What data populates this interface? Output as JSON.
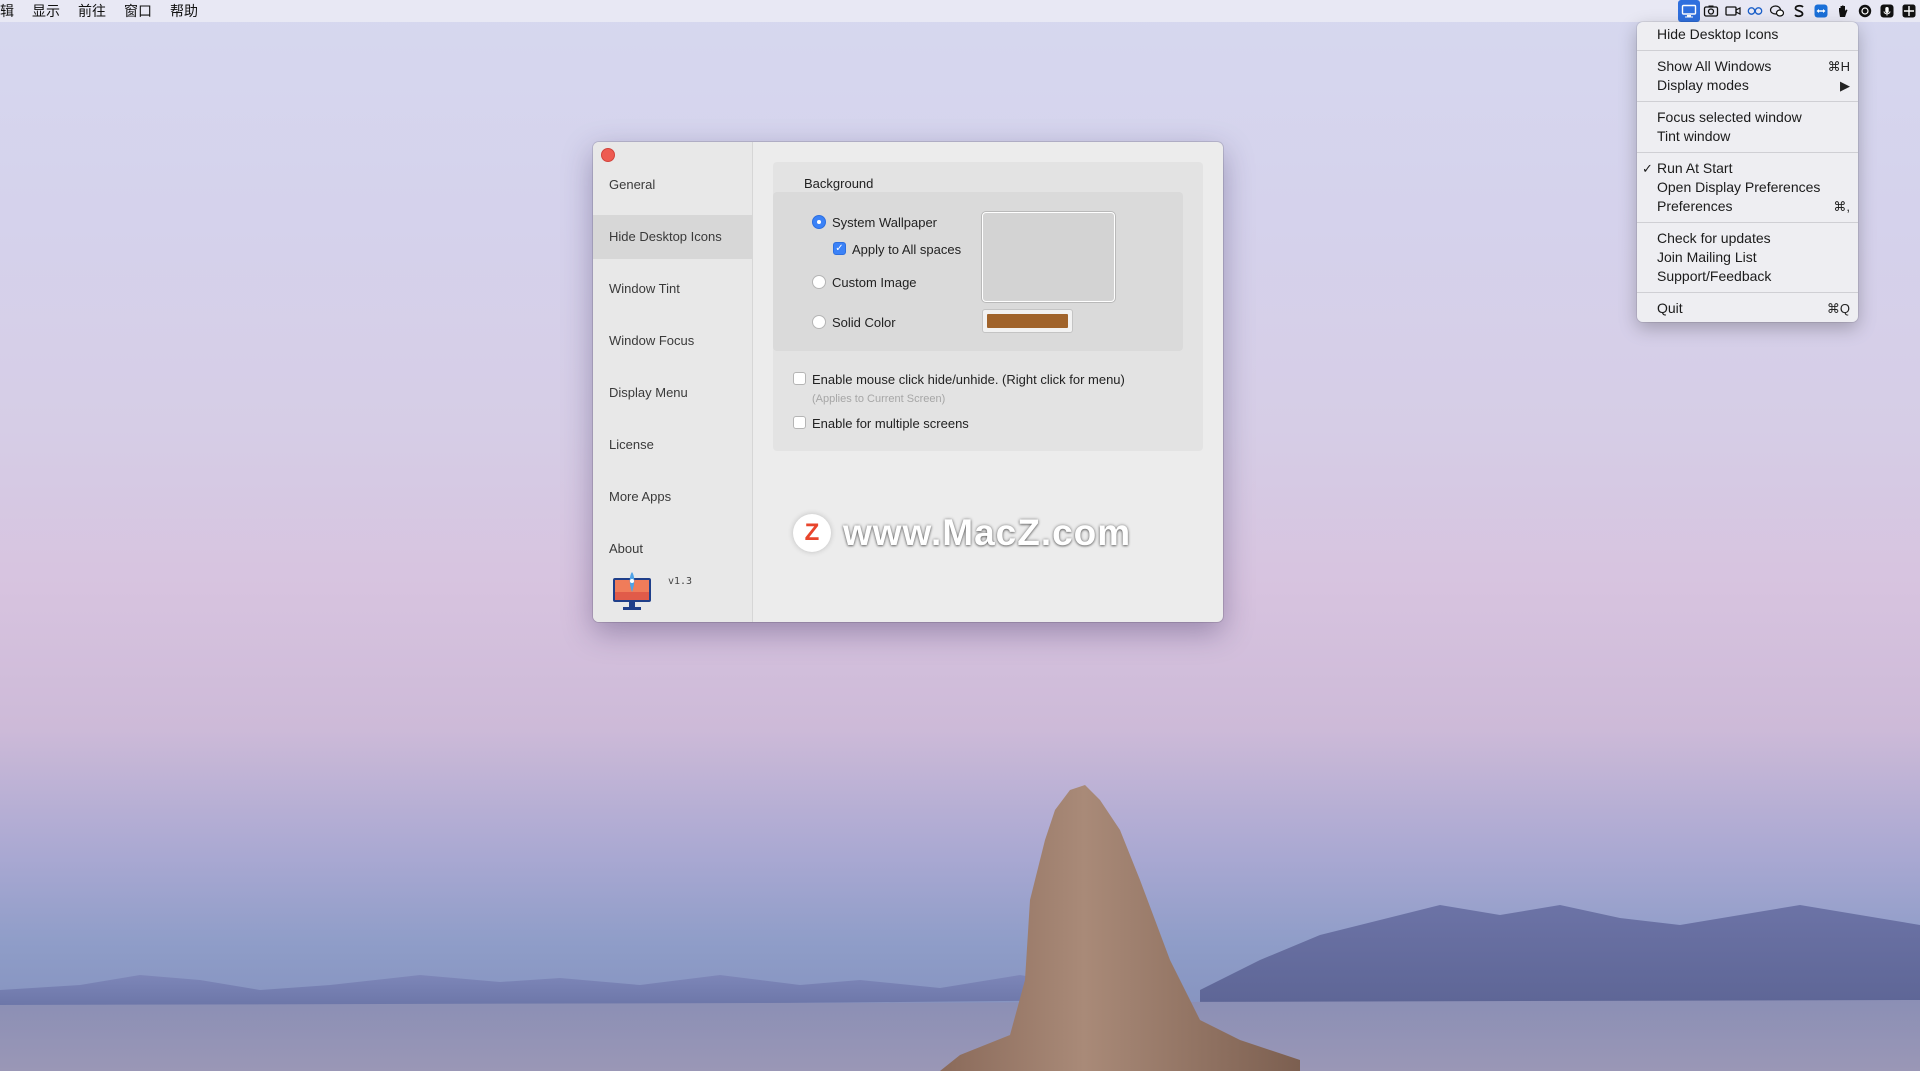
{
  "menubar": {
    "items": [
      "辑",
      "显示",
      "前往",
      "窗口",
      "帮助"
    ],
    "status_icons": [
      "display-icon",
      "camera-icon",
      "video-icon",
      "glasses-icon",
      "wechat-icon",
      "s-icon",
      "teamviewer-icon",
      "hand-icon",
      "circle-icon",
      "mic-icon",
      "grid-icon"
    ]
  },
  "menu": {
    "items": [
      {
        "label": "Hide Desktop Icons",
        "shortcut": ""
      },
      {
        "label": "Show All Windows",
        "shortcut": "⌘H"
      },
      {
        "label": "Display modes",
        "shortcut": "▶"
      },
      {
        "label": "Focus selected window",
        "shortcut": ""
      },
      {
        "label": "Tint window",
        "shortcut": ""
      },
      {
        "label": "Run At Start",
        "shortcut": "",
        "checked": true
      },
      {
        "label": "Open Display Preferences",
        "shortcut": ""
      },
      {
        "label": "Preferences",
        "shortcut": "⌘,"
      },
      {
        "label": "Check for updates",
        "shortcut": ""
      },
      {
        "label": "Join Mailing List",
        "shortcut": ""
      },
      {
        "label": "Support/Feedback",
        "shortcut": ""
      },
      {
        "label": "Quit",
        "shortcut": "⌘Q"
      }
    ],
    "check_glyph": "✓"
  },
  "window": {
    "sidebar": {
      "items": [
        "General",
        "Hide Desktop Icons",
        "Window Tint",
        "Window Focus",
        "Display Menu",
        "License",
        "More Apps",
        "About"
      ],
      "selected": "Hide Desktop Icons",
      "version": "v1.3"
    },
    "background": {
      "label": "Background",
      "system_wallpaper": "System Wallpaper",
      "apply_all_spaces": "Apply to All spaces",
      "custom_image": "Custom Image",
      "solid_color": "Solid Color",
      "selected_option": "System Wallpaper",
      "apply_all_spaces_checked": true,
      "solid_color_value": "#a0632b"
    },
    "options": {
      "mouse_click": "Enable mouse click hide/unhide. (Right click for menu)",
      "mouse_click_note": "(Applies to Current Screen)",
      "multiple_screens": "Enable for multiple screens"
    }
  },
  "watermark": {
    "badge": "Z",
    "text": "www.MacZ.com"
  },
  "colors": {
    "accent": "#3b82f7",
    "close": "#ee5b52"
  }
}
